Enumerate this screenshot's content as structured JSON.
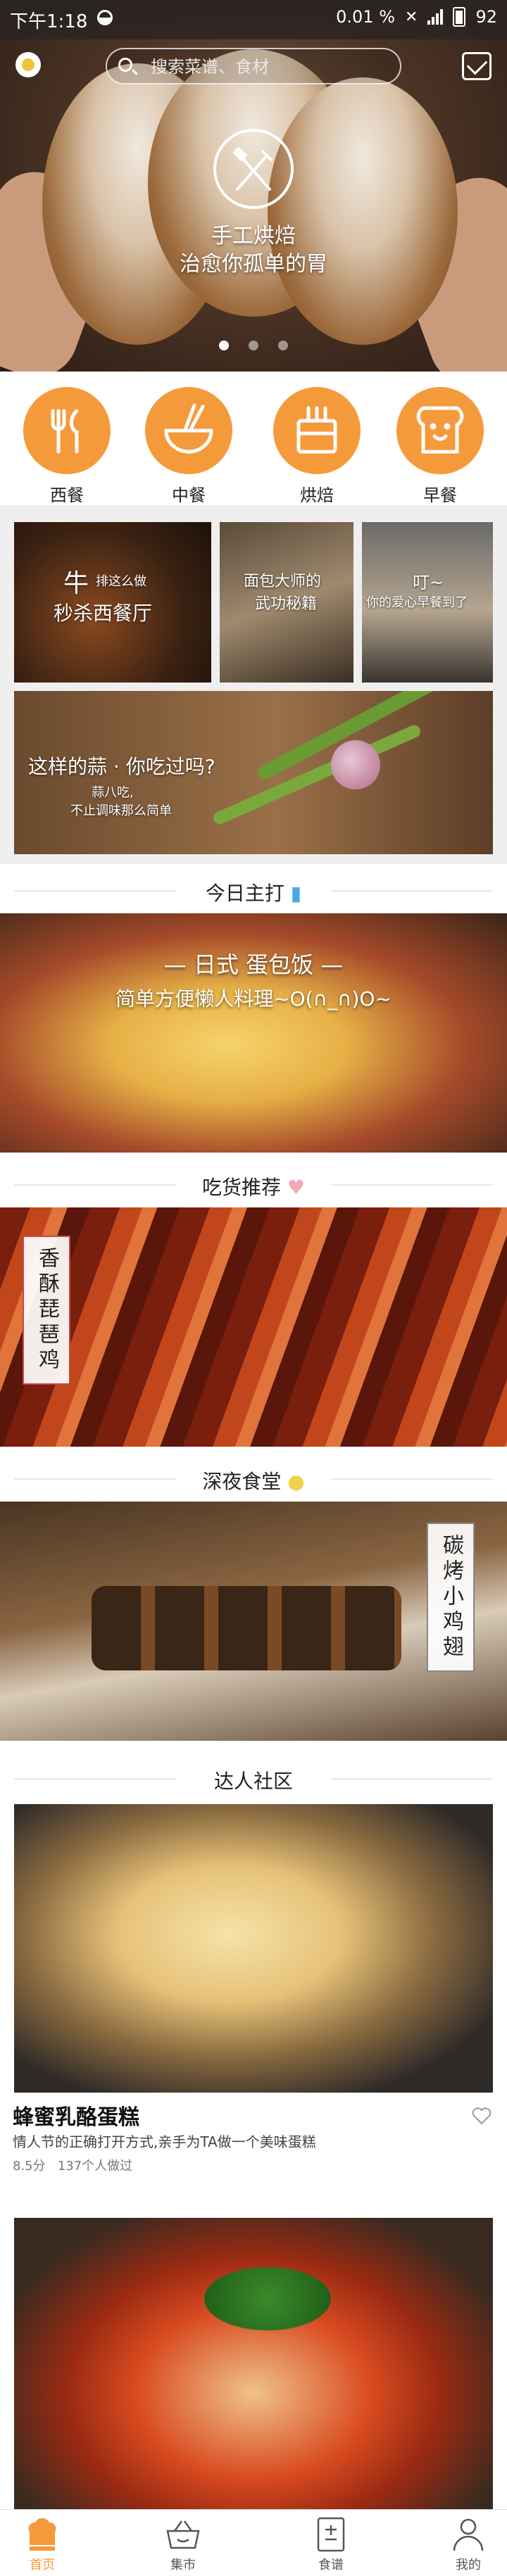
{
  "status_bar": {
    "time": "下午1:18",
    "speed": "0.01 %",
    "battery": "92"
  },
  "search": {
    "placeholder": "搜索菜谱、食材"
  },
  "hero": {
    "line1": "手工烘焙",
    "line2": "治愈你孤单的胃",
    "slide_count": 3,
    "active_slide": 1
  },
  "categories": [
    {
      "label": "西餐",
      "icon": "fork-knife-icon"
    },
    {
      "label": "中餐",
      "icon": "bowl-chopsticks-icon"
    },
    {
      "label": "烘焙",
      "icon": "cake-icon"
    },
    {
      "label": "早餐",
      "icon": "toast-icon"
    }
  ],
  "tiles": {
    "t1": {
      "big": "牛",
      "small": "排这么做",
      "line2": "秒杀西餐厅"
    },
    "t2": {
      "line1": "面包大师的",
      "line2": "武功秘籍"
    },
    "t3": {
      "line1": "叮~",
      "line2": "你的爱心早餐到了"
    },
    "t4": {
      "line1": "这样的蒜 · 你吃过吗?",
      "line2": "蒜八吃,",
      "line3": "不止调味那么简单"
    }
  },
  "sections": {
    "today": {
      "title": "今日主打"
    },
    "foodie": {
      "title": "吃货推荐"
    },
    "night": {
      "title": "深夜食堂"
    },
    "community": {
      "title": "达人社区"
    }
  },
  "today_banner": {
    "line1": "日式  蛋包饭",
    "line2": "简单方便懒人料理~O(∩_∩)O~"
  },
  "foodie_banner": {
    "label": "香酥琵琶鸡"
  },
  "night_banner": {
    "label": "碳烤小鸡翅"
  },
  "community_post": {
    "title": "蜂蜜乳酪蛋糕",
    "desc": "情人节的正确打开方式,亲手为TA做一个美味蛋糕",
    "score": "8.5分",
    "count": "137个人做过"
  },
  "tabs": [
    {
      "label": "首页",
      "icon": "home-chef-hat-icon",
      "active": true
    },
    {
      "label": "集市",
      "icon": "basket-icon",
      "active": false
    },
    {
      "label": "食谱",
      "icon": "recipe-book-icon",
      "active": false
    },
    {
      "label": "我的",
      "icon": "user-icon",
      "active": false
    }
  ],
  "colors": {
    "accent": "#f59a3a",
    "heading_text": "#222222"
  }
}
